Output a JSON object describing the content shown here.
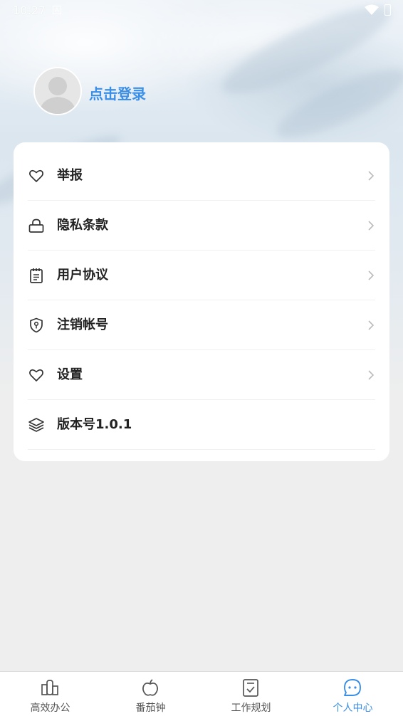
{
  "status_bar": {
    "time": "10:27",
    "notification_icon": "a-icon"
  },
  "profile": {
    "login_text": "点击登录"
  },
  "menu": {
    "items": [
      {
        "label": "举报",
        "icon": "heart-icon"
      },
      {
        "label": "隐私条款",
        "icon": "lock-icon"
      },
      {
        "label": "用户协议",
        "icon": "notepad-icon"
      },
      {
        "label": "注销帐号",
        "icon": "shield-key-icon"
      },
      {
        "label": "设置",
        "icon": "heart-icon"
      },
      {
        "label": "版本号1.0.1",
        "icon": "layers-icon"
      }
    ]
  },
  "bottom_nav": {
    "items": [
      {
        "label": "高效办公",
        "icon": "building-icon"
      },
      {
        "label": "番茄钟",
        "icon": "apple-icon"
      },
      {
        "label": "工作规划",
        "icon": "checklist-icon"
      },
      {
        "label": "个人中心",
        "icon": "chat-face-icon"
      }
    ],
    "active_index": 3
  },
  "colors": {
    "accent": "#3a8ee6",
    "text": "#222222",
    "background": "#eeeeee"
  }
}
